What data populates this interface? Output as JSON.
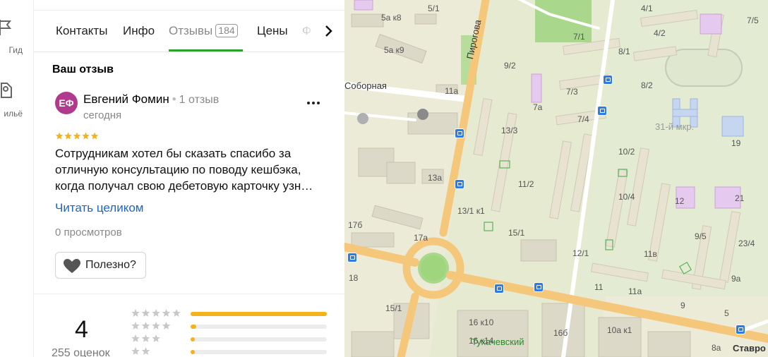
{
  "rail": {
    "items": [
      {
        "label": "Гид",
        "icon": "flag-icon"
      },
      {
        "label": "ильё",
        "icon": "hotel-icon"
      }
    ]
  },
  "tabs": {
    "items": [
      {
        "label": "Контакты"
      },
      {
        "label": "Инфо"
      },
      {
        "label": "Отзывы",
        "count": "184",
        "active": true
      },
      {
        "label": "Цены"
      },
      {
        "label": "Ф"
      }
    ]
  },
  "review": {
    "section_title": "Ваш отзыв",
    "avatar_initials": "ЕФ",
    "avatar_color": "#b03a8e",
    "author": "Евгений Фомин",
    "author_reviews": "1 отзыв",
    "date": "сегодня",
    "stars": 5,
    "text": "Сотрудникам хотел бы сказать спасибо за отличную консультацию по поводу кешбэка, когда получал свою дебетовую карточку узн…",
    "read_more": "Читать целиком",
    "views": "0 просмотров",
    "useful_label": "Полезно?"
  },
  "summary": {
    "score": "4",
    "count_label": "255 оценок",
    "distribution": [
      {
        "stars": 5,
        "fraction": 1.0
      },
      {
        "stars": 4,
        "fraction": 0.04
      },
      {
        "stars": 3,
        "fraction": 0.03
      },
      {
        "stars": 2,
        "fraction": 0.03
      }
    ]
  },
  "colors": {
    "accent_green": "#2ca02c",
    "link_blue": "#1b66c9",
    "star_gold": "#f5b21b",
    "stop_blue": "#2d7be5"
  },
  "map": {
    "streets": [
      "Соборная",
      "Пирогова",
      "Тухачевский",
      "Ставро"
    ],
    "districts": [
      "31-й мкр."
    ],
    "labels": [
      "5/1",
      "4/1",
      "7/5",
      "5а к8",
      "7/1",
      "4/2",
      "5а к9",
      "8/1",
      "9/2",
      "11а",
      "7/3",
      "8/2",
      "7а",
      "7/4",
      "13/3",
      "10/2",
      "19",
      "11/2",
      "13а",
      "10/4",
      "12",
      "21",
      "13/1 к1",
      "17б",
      "15/1",
      "9/5",
      "17а",
      "12/1",
      "11в",
      "23/4",
      "18",
      "9а",
      "15/1",
      "11",
      "11а",
      "9",
      "16 к10",
      "16б",
      "10а к1",
      "5",
      "16 к14",
      "8а"
    ]
  }
}
